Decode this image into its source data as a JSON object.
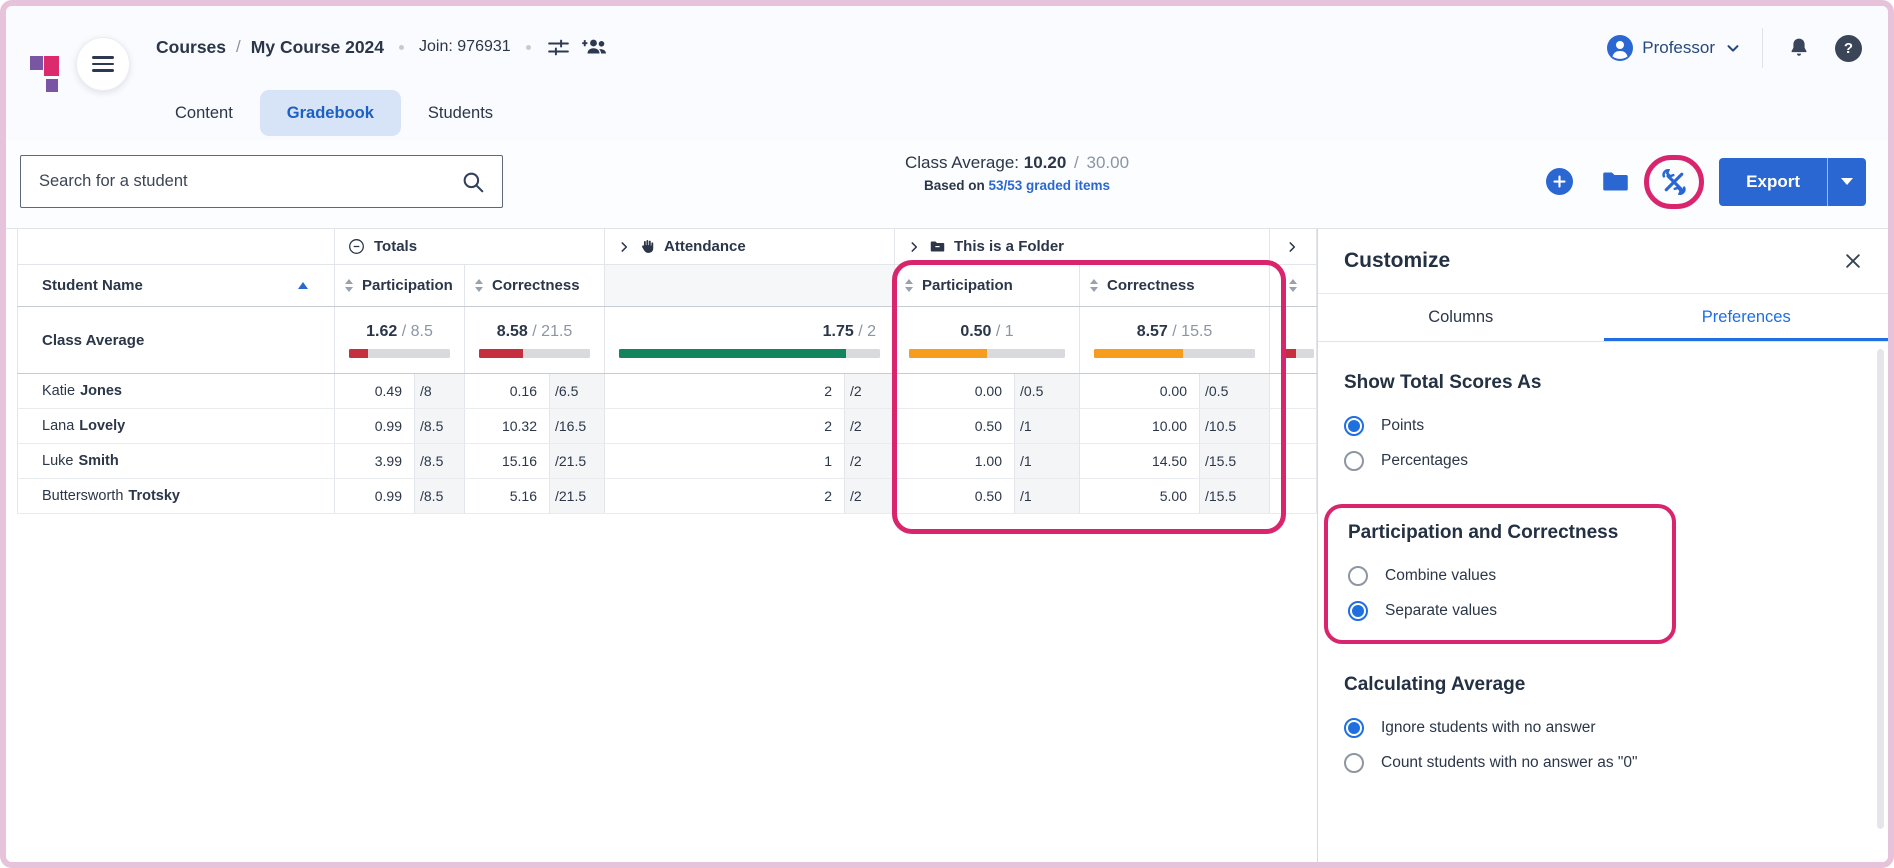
{
  "header": {
    "breadcrumb": {
      "root": "Courses",
      "separator": "/",
      "current": "My Course 2024"
    },
    "join_code": "Join: 976931",
    "tabs": [
      {
        "label": "Content",
        "active": false
      },
      {
        "label": "Gradebook",
        "active": true
      },
      {
        "label": "Students",
        "active": false
      }
    ],
    "profile": {
      "name": "Professor"
    }
  },
  "toolbar": {
    "search": {
      "placeholder": "Search for a student"
    },
    "class_average": {
      "label": "Class Average:",
      "score": "10.20",
      "separator": "/",
      "max": "30.00",
      "based_on": "Based on",
      "graded_items_link": "53/53 graded items"
    },
    "export_label": "Export"
  },
  "table": {
    "groups": {
      "totals": "Totals",
      "attendance": "Attendance",
      "folder": "This is a Folder"
    },
    "columns": {
      "student": "Student Name",
      "participation": "Participation",
      "correctness": "Correctness"
    },
    "class_average_row": {
      "label": "Class Average",
      "cells": [
        {
          "column": "totals-participation",
          "score": "1.62",
          "max": "8.5",
          "percent": 19,
          "color": "#c62f3d"
        },
        {
          "column": "totals-correctness",
          "score": "8.58",
          "max": "21.5",
          "percent": 40,
          "color": "#c62f3d"
        },
        {
          "column": "attendance",
          "score": "1.75",
          "max": "2",
          "percent": 87,
          "color": "#12855c"
        },
        {
          "column": "folder-participation",
          "score": "0.50",
          "max": "1",
          "percent": 50,
          "color": "#f79d1e"
        },
        {
          "column": "folder-correctness",
          "score": "8.57",
          "max": "15.5",
          "percent": 55,
          "color": "#f79d1e"
        }
      ],
      "partial_cell": {
        "percent": 40,
        "color": "#c62f3d"
      }
    },
    "rows": [
      {
        "first_name": "Katie",
        "last_name": "Jones",
        "cells": [
          {
            "score": "0.49",
            "max": "/8"
          },
          {
            "score": "0.16",
            "max": "/6.5"
          },
          {
            "score": "2",
            "max": "/2"
          },
          {
            "score": "0.00",
            "max": "/0.5"
          },
          {
            "score": "0.00",
            "max": "/0.5"
          }
        ]
      },
      {
        "first_name": "Lana",
        "last_name": "Lovely",
        "cells": [
          {
            "score": "0.99",
            "max": "/8.5"
          },
          {
            "score": "10.32",
            "max": "/16.5"
          },
          {
            "score": "2",
            "max": "/2"
          },
          {
            "score": "0.50",
            "max": "/1"
          },
          {
            "score": "10.00",
            "max": "/10.5"
          }
        ]
      },
      {
        "first_name": "Luke",
        "last_name": "Smith",
        "cells": [
          {
            "score": "3.99",
            "max": "/8.5"
          },
          {
            "score": "15.16",
            "max": "/21.5"
          },
          {
            "score": "1",
            "max": "/2"
          },
          {
            "score": "1.00",
            "max": "/1"
          },
          {
            "score": "14.50",
            "max": "/15.5"
          }
        ]
      },
      {
        "first_name": "Buttersworth",
        "last_name": "Trotsky",
        "cells": [
          {
            "score": "0.99",
            "max": "/8.5"
          },
          {
            "score": "5.16",
            "max": "/21.5"
          },
          {
            "score": "2",
            "max": "/2"
          },
          {
            "score": "0.50",
            "max": "/1"
          },
          {
            "score": "5.00",
            "max": "/15.5"
          }
        ]
      }
    ]
  },
  "customize": {
    "title": "Customize",
    "tabs": [
      {
        "label": "Columns",
        "active": false
      },
      {
        "label": "Preferences",
        "active": true
      }
    ],
    "sections": {
      "show_total": {
        "heading": "Show Total Scores As",
        "options": [
          {
            "label": "Points",
            "selected": true
          },
          {
            "label": "Percentages",
            "selected": false
          }
        ]
      },
      "participation_correctness": {
        "heading": "Participation and Correctness",
        "options": [
          {
            "label": "Combine values",
            "selected": false
          },
          {
            "label": "Separate values",
            "selected": true
          }
        ]
      },
      "calculating_average": {
        "heading": "Calculating Average",
        "options": [
          {
            "label": "Ignore students with no answer",
            "selected": true
          },
          {
            "label": "Count students with no answer as \"0\"",
            "selected": false
          }
        ]
      }
    }
  },
  "colors": {
    "accent_blue": "#2a67d3",
    "active_tab_blue": "#1f6fe0",
    "annotation_pink": "#d8256d",
    "bar_red": "#c62f3d",
    "bar_green": "#12855c",
    "bar_orange": "#f79d1e",
    "bar_track": "#d8dade"
  }
}
